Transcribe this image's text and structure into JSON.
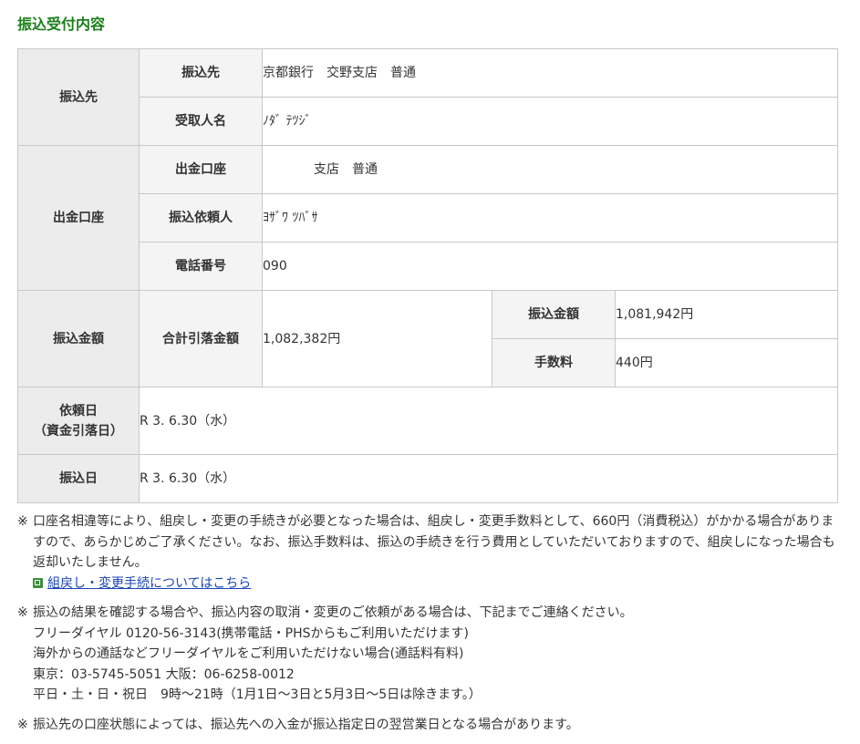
{
  "page_title": "振込受付内容",
  "payee": {
    "header": "振込先",
    "rows": [
      {
        "label": "振込先",
        "value": "京都銀行　交野支店　普通"
      },
      {
        "label": "受取人名",
        "value": "ﾉﾀﾞ ﾃﾂｼﾞ"
      }
    ]
  },
  "source": {
    "header": "出金口座",
    "rows": [
      {
        "label": "出金口座",
        "value": "　　　　支店　普通"
      },
      {
        "label": "振込依頼人",
        "value": "ﾖｻﾞﾜ ﾂﾊﾞｻ"
      },
      {
        "label": "電話番号",
        "value": "090"
      }
    ]
  },
  "amount": {
    "header": "振込金額",
    "total_label": "合計引落金額",
    "total_value": "1,082,382円",
    "transfer_label": "振込金額",
    "transfer_value": "1,081,942円",
    "fee_label": "手数料",
    "fee_value": "440円"
  },
  "request_date": {
    "header_line1": "依頼日",
    "header_line2": "（資金引落日）",
    "value": "R 3. 6.30（水）"
  },
  "transfer_date": {
    "header": "振込日",
    "value": "R 3. 6.30（水）"
  },
  "notes": {
    "mark": "※",
    "note1_text": "口座名相違等により、組戻し・変更の手続きが必要となった場合は、組戻し・変更手数料として、660円（消費税込）がかかる場合がありますので、あらかじめご了承ください。なお、振込手数料は、振込の手続きを行う費用としていただいておりますので、組戻しになった場合も返却いたしません。",
    "note1_link": "組戻し・変更手続についてはこちら",
    "note2_lines": [
      "振込の結果を確認する場合や、振込内容の取消・変更のご依頼がある場合は、下記までご連絡ください。",
      "フリーダイヤル 0120-56-3143(携帯電話・PHSからもご利用いただけます)",
      "海外からの通話などフリーダイヤルをご利用いただけない場合(通話料有料)",
      "東京：03-5745-5051 大阪：06-6258-0012",
      "平日・土・日・祝日　9時～21時（1月1日～3日と5月3日～5日は除きます。）"
    ],
    "note3_text": "振込先の口座状態によっては、振込先への入金が振込指定日の翌営業日となる場合があります。"
  },
  "colors": {
    "title": "#1a7f1a",
    "link": "#1a44b8",
    "header_bg": "#ececec",
    "subheader_bg": "#f4f4f4",
    "border": "#c8c8c8"
  }
}
